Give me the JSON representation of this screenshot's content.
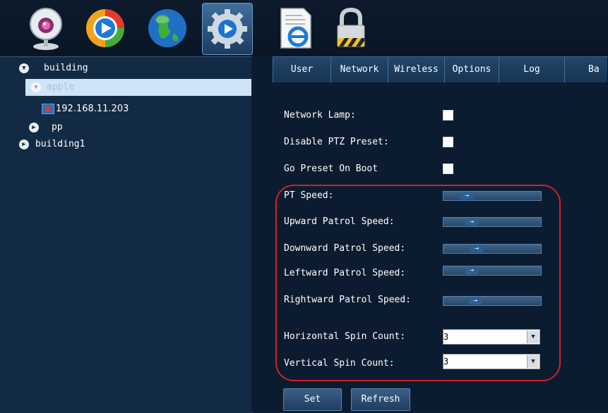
{
  "toolbar": {
    "icons": [
      "webcam-icon",
      "media-play-icon",
      "globe-icon",
      "settings-gear-icon",
      "document-ie-icon",
      "padlock-icon"
    ],
    "active": "settings-gear-icon"
  },
  "tree": {
    "nodes": [
      {
        "label": "building",
        "state": "expanded"
      },
      {
        "label": "apple",
        "state": "expanded",
        "selected": true
      },
      {
        "label": "192.168.11.203"
      },
      {
        "label": "pp",
        "state": "collapsed"
      },
      {
        "label": "building1",
        "state": "collapsed"
      }
    ]
  },
  "tabs": [
    "User",
    "Network",
    "Wireless",
    "Options",
    "Log",
    "Ba"
  ],
  "form": {
    "network_lamp": "Network Lamp:",
    "disable_ptz": "Disable PTZ Preset:",
    "go_preset": "Go Preset On Boot",
    "pt_speed": "PT Speed:",
    "upward": "Upward Patrol Speed:",
    "downward": "Downward Patrol Speed:",
    "leftward": "Leftward Patrol Speed:",
    "rightward": "Rightward Patrol Speed:",
    "horizontal_spin": "Horizontal Spin Count:",
    "vertical_spin": "Vertical Spin Count:",
    "horizontal_value": "3",
    "vertical_value": "3",
    "slider_glyph": "→"
  },
  "buttons": {
    "set": "Set",
    "refresh": "Refresh"
  },
  "colors": {
    "background": "#0e1f33",
    "highlight": "#d0202a",
    "selected_row": "#cfe4f7"
  }
}
